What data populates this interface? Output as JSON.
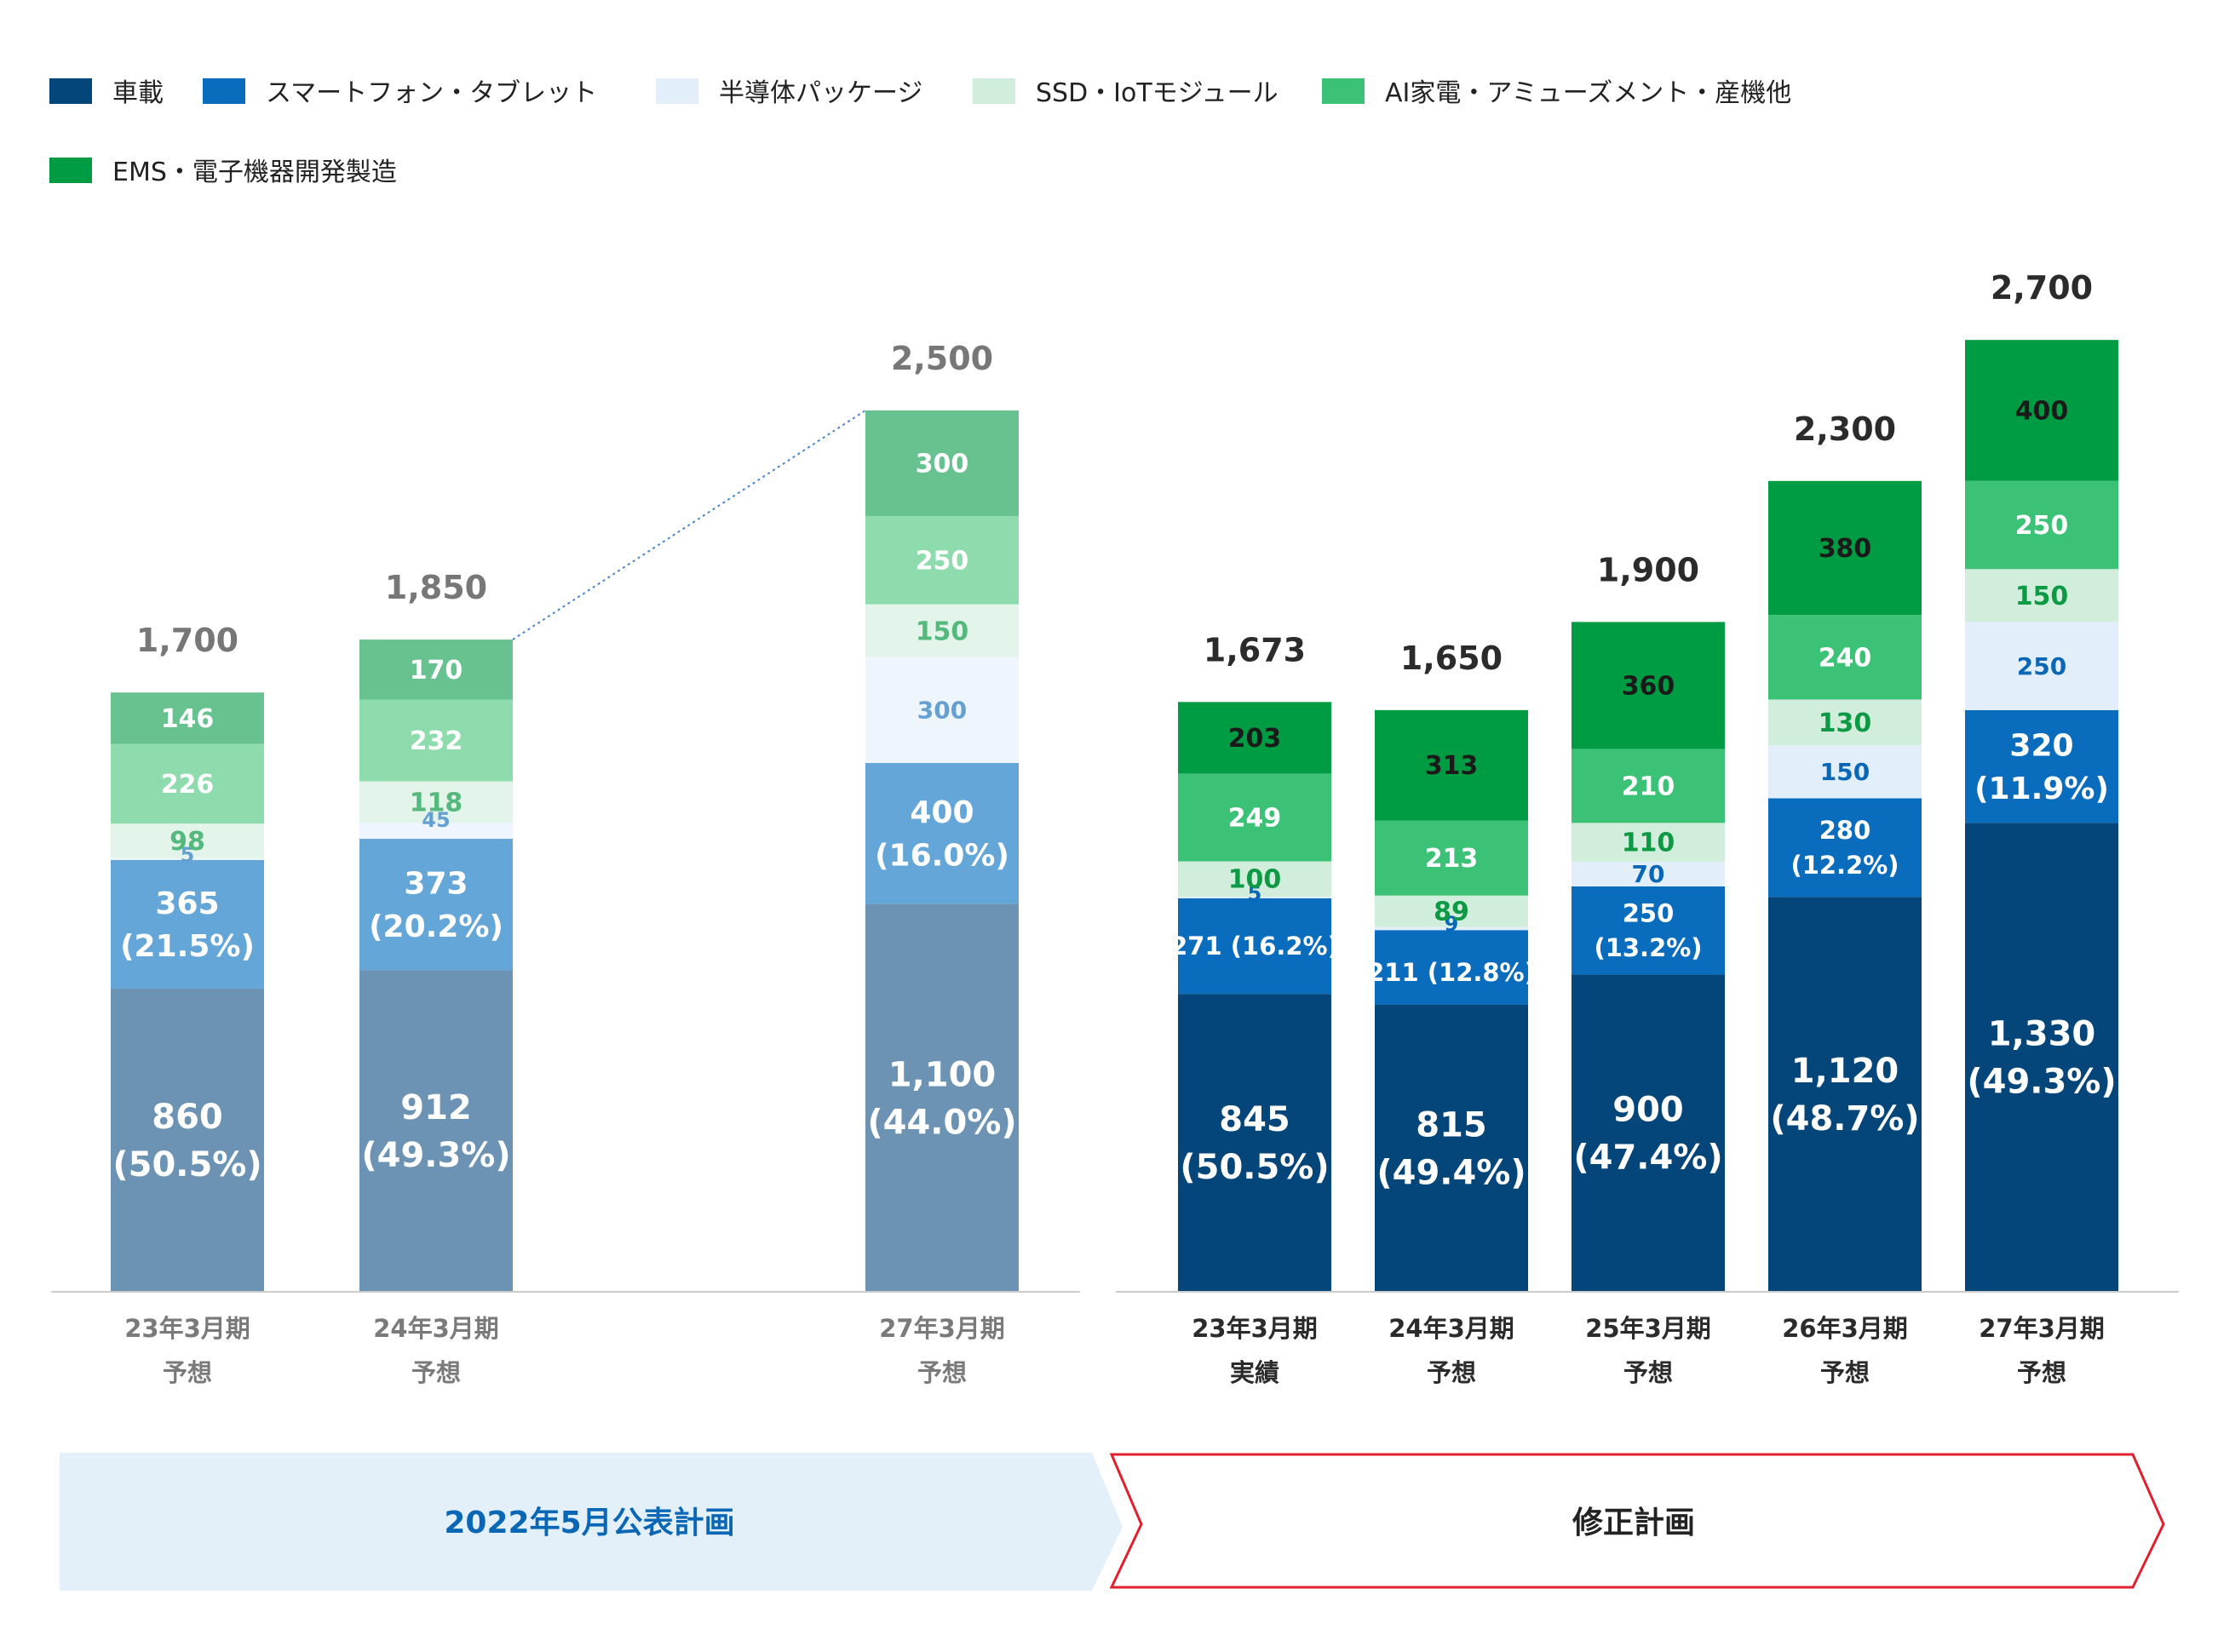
{
  "legend": [
    {
      "label": "車載",
      "color": "#05467a"
    },
    {
      "label": "スマートフォン・タブレット",
      "color": "#0a6cbd"
    },
    {
      "label": "半導体パッケージ",
      "color": "#e2effa"
    },
    {
      "label": "SSD・IoTモジュール",
      "color": "#d0eedb"
    },
    {
      "label": "AI家電・アミューズメント・産機他",
      "color": "#3cc277"
    },
    {
      "label": "EMS・電子機器開発製造",
      "color": "#009c44"
    }
  ],
  "banners": {
    "left": "2022年5月公表計画",
    "right": "修正計画"
  },
  "colors": {
    "old_plan": [
      "#6c93b3",
      "#65a6d8",
      "#eef5fc",
      "#e3f4ea",
      "#8edcad",
      "#67c290"
    ],
    "old_total_text": "#777777",
    "old_cat_text": "#7a7a7a",
    "new_total_text": "#2b2b2b",
    "new_cat_text": "#2b2b2b",
    "banner_left_fill": "#e3f0fa",
    "banner_left_text": "#0a67b5",
    "banner_right_border": "#e0202e",
    "banner_right_text": "#222222",
    "axis_line": "#cccccc",
    "dotted_connector": "#4a86c8"
  },
  "chart_data": {
    "type": "bar",
    "stacked": true,
    "ylim": [
      0,
      2800
    ],
    "series_names": [
      "車載",
      "スマートフォン・タブレット",
      "半導体パッケージ",
      "SSD・IoTモジュール",
      "AI家電・アミューズメント・産機他",
      "EMS・電子機器開発製造"
    ],
    "groups": [
      {
        "name": "2022年5月公表計画",
        "bars": [
          {
            "category": [
              "23年3月期",
              "予想"
            ],
            "values": [
              860,
              365,
              5,
              98,
              226,
              146
            ],
            "labels": [
              "860|(50.5%)",
              "365|(21.5%)",
              "5",
              "98",
              "226",
              "146"
            ],
            "total": "1,700"
          },
          {
            "category": [
              "24年3月期",
              "予想"
            ],
            "values": [
              912,
              373,
              45,
              118,
              232,
              170
            ],
            "labels": [
              "912|(49.3%)",
              "373|(20.2%)",
              "45",
              "118",
              "232",
              "170"
            ],
            "total": "1,850"
          },
          {
            "category": [
              "27年3月期",
              "予想"
            ],
            "values": [
              1100,
              400,
              300,
              150,
              250,
              300
            ],
            "labels": [
              "1,100|(44.0%)",
              "400|(16.0%)",
              "300",
              "150",
              "250",
              "300"
            ],
            "total": "2,500"
          }
        ]
      },
      {
        "name": "修正計画",
        "bars": [
          {
            "category": [
              "23年3月期",
              "実績"
            ],
            "values": [
              845,
              271,
              5,
              100,
              249,
              203
            ],
            "labels": [
              "845|(50.5%)",
              "271 (16.2%)",
              "5",
              "100",
              "249",
              "203"
            ],
            "total": "1,673"
          },
          {
            "category": [
              "24年3月期",
              "予想"
            ],
            "values": [
              815,
              211,
              9,
              89,
              213,
              313
            ],
            "labels": [
              "815|(49.4%)",
              "211 (12.8%)",
              "9",
              "89",
              "213",
              "313"
            ],
            "total": "1,650"
          },
          {
            "category": [
              "25年3月期",
              "予想"
            ],
            "values": [
              900,
              250,
              70,
              110,
              210,
              360
            ],
            "labels": [
              "900|(47.4%)",
              "250|(13.2%)",
              "70",
              "110",
              "210",
              "360"
            ],
            "total": "1,900"
          },
          {
            "category": [
              "26年3月期",
              "予想"
            ],
            "values": [
              1120,
              280,
              150,
              130,
              240,
              380
            ],
            "labels": [
              "1,120|(48.7%)",
              "280|(12.2%)",
              "150",
              "130",
              "240",
              "380"
            ],
            "total": "2,300"
          },
          {
            "category": [
              "27年3月期",
              "予想"
            ],
            "values": [
              1330,
              320,
              250,
              150,
              250,
              400
            ],
            "labels": [
              "1,330|(49.3%)",
              "320|(11.9%)",
              "250",
              "150",
              "250",
              "400"
            ],
            "total": "2,700"
          }
        ]
      }
    ]
  }
}
